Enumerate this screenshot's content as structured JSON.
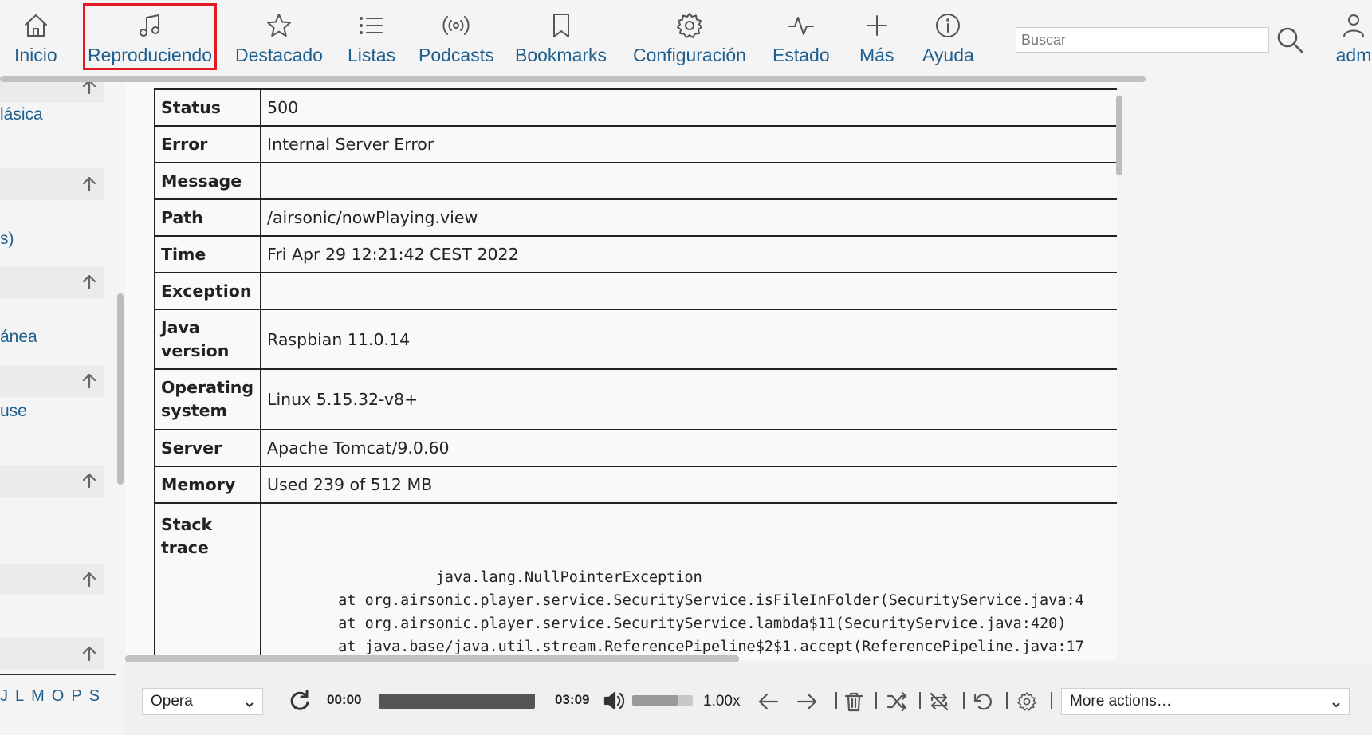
{
  "nav": {
    "items": [
      {
        "label": "Inicio",
        "icon": "home-icon"
      },
      {
        "label": "Reproduciendo",
        "icon": "music-note-icon",
        "active": true
      },
      {
        "label": "Destacado",
        "icon": "star-icon"
      },
      {
        "label": "Listas",
        "icon": "list-icon"
      },
      {
        "label": "Podcasts",
        "icon": "podcast-icon"
      },
      {
        "label": "Bookmarks",
        "icon": "bookmark-icon"
      },
      {
        "label": "Configuración",
        "icon": "gear-icon"
      },
      {
        "label": "Estado",
        "icon": "activity-icon"
      },
      {
        "label": "Más",
        "icon": "plus-icon"
      },
      {
        "label": "Ayuda",
        "icon": "info-icon"
      }
    ],
    "search_placeholder": "Buscar",
    "user_label": "adm",
    "active_color": "#e01b24",
    "link_color": "#1d5f8f"
  },
  "sidebar": {
    "links": [
      "lásica",
      "s)",
      "ánea",
      "use"
    ],
    "alphabet": [
      "J",
      "L",
      "M",
      "O",
      "P",
      "S"
    ]
  },
  "error": {
    "rows": [
      {
        "label": "Status",
        "value": "500"
      },
      {
        "label": "Error",
        "value": "Internal Server Error"
      },
      {
        "label": "Message",
        "value": ""
      },
      {
        "label": "Path",
        "value": "/airsonic/nowPlaying.view"
      },
      {
        "label": "Time",
        "value": "Fri Apr 29 12:21:42 CEST 2022"
      },
      {
        "label": "Exception",
        "value": ""
      },
      {
        "label": "Java version",
        "value": "Raspbian 11.0.14"
      },
      {
        "label": "Operating system",
        "value": "Linux 5.15.32-v8+"
      },
      {
        "label": "Server",
        "value": "Apache Tomcat/9.0.60"
      },
      {
        "label": "Memory",
        "value": "Used 239 of 512 MB"
      }
    ],
    "stack_label": "Stack trace",
    "stack_lines": [
      "                   java.lang.NullPointerException",
      "        at org.airsonic.player.service.SecurityService.isFileInFolder(SecurityService.java:4",
      "        at org.airsonic.player.service.SecurityService.lambda$11(SecurityService.java:420)",
      "        at java.base/java.util.stream.ReferencePipeline$2$1.accept(ReferencePipeline.java:17"
    ]
  },
  "player": {
    "select_value": "Opera",
    "time_current": "00:00",
    "time_total": "03:09",
    "volume_level": 0.75,
    "speed": "1.00x",
    "more_actions": "More actions…"
  }
}
